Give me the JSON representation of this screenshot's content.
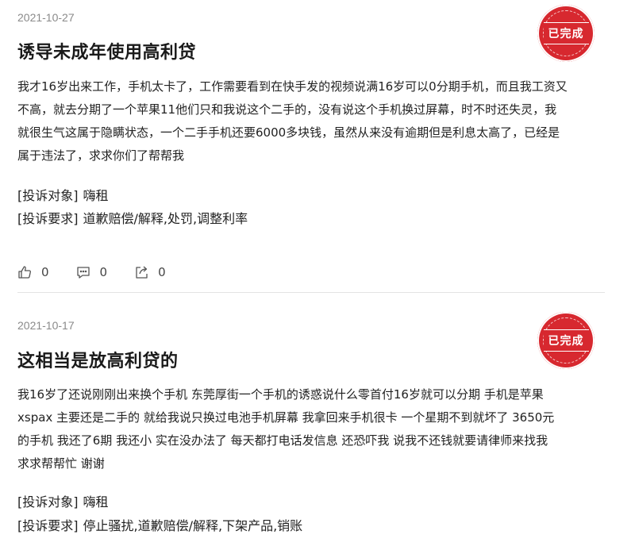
{
  "complaints": [
    {
      "date": "2021-10-27",
      "status": "已完成",
      "title": "诱导未成年使用高利贷",
      "lines": [
        "我才16岁出来工作，手机太卡了，工作需要看到在快手发的视频说满16岁可以0分期手机，而且我工资又",
        "不高，就去分期了一个苹果11他们只和我说这个二手的，没有说这个手机换过屏幕，时不时还失灵，我",
        "就很生气这属于隐瞒状态，一个二手手机还要6000多块钱，虽然从来没有逾期但是利息太高了，已经是",
        "属于违法了，求求你们了帮帮我"
      ],
      "target_label": "[投诉对象]",
      "target_value": "嗨租",
      "demand_label": "[投诉要求]",
      "demand_value": "道歉赔偿/解释,处罚,调整利率",
      "likes": "0",
      "comments": "0",
      "shares": "0"
    },
    {
      "date": "2021-10-17",
      "status": "已完成",
      "title": "这相当是放高利贷的",
      "lines": [
        "我16岁了还说刚刚出来换个手机 东莞厚街一个手机的诱惑说什么零首付16岁就可以分期 手机是苹果",
        "xspax 主要还是二手的 就给我说只换过电池手机屏幕 我拿回来手机很卡 一个星期不到就坏了 3650元",
        "的手机 我还了6期 我还小 实在没办法了 每天都打电话发信息 还恐吓我 说我不还钱就要请律师来找我",
        "求求帮帮忙 谢谢"
      ],
      "target_label": "[投诉对象]",
      "target_value": "嗨租",
      "demand_label": "[投诉要求]",
      "demand_value": "停止骚扰,道歉赔偿/解释,下架产品,销账"
    }
  ],
  "colors": {
    "stamp": "#d7282f",
    "divider": "#e4e4e4",
    "date": "#8a8a8a"
  },
  "icons": {
    "like": "thumbs-up-icon",
    "comment": "comment-icon",
    "share": "share-icon",
    "stamp": "completed-stamp"
  }
}
